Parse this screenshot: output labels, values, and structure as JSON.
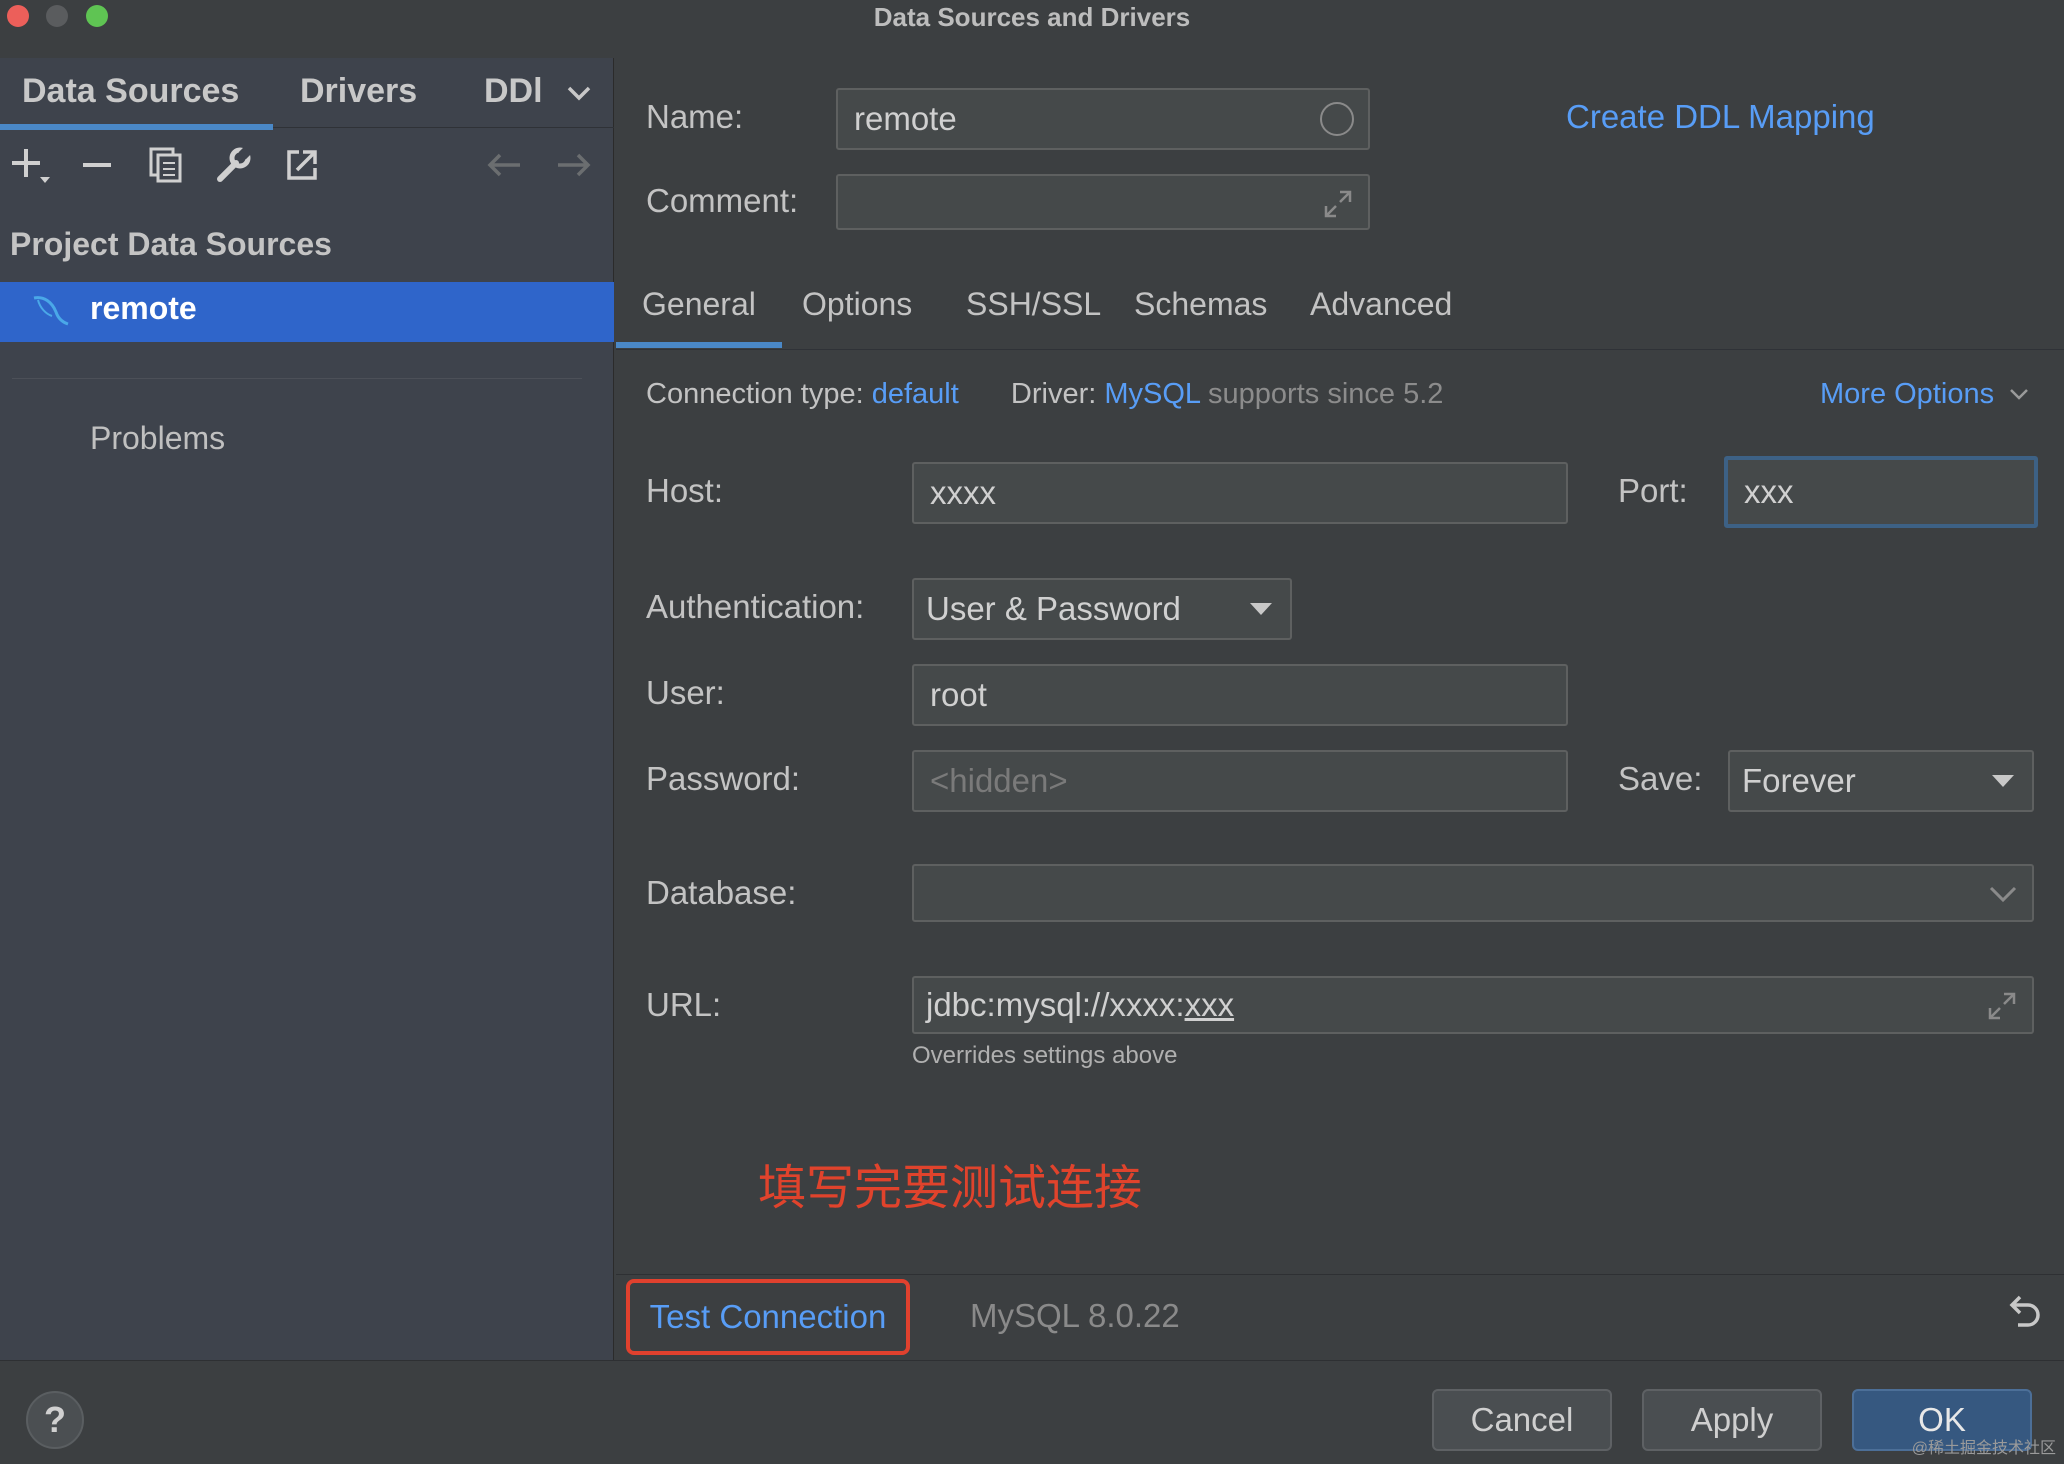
{
  "window": {
    "title": "Data Sources and Drivers"
  },
  "left": {
    "tabs": [
      "Data Sources",
      "Drivers",
      "DDl"
    ],
    "section_title": "Project Data Sources",
    "selected_source": "remote",
    "problems_label": "Problems"
  },
  "form": {
    "name_label": "Name:",
    "name_value": "remote",
    "create_ddl_link": "Create DDL Mapping",
    "comment_label": "Comment:",
    "comment_value": "",
    "tabs": [
      "General",
      "Options",
      "SSH/SSL",
      "Schemas",
      "Advanced"
    ],
    "connection_type_label": "Connection type:",
    "connection_type_value": "default",
    "driver_label": "Driver:",
    "driver_value": "MySQL",
    "driver_note": "supports since 5.2",
    "more_options": "More Options",
    "host_label": "Host:",
    "host_value": "xxxx",
    "port_label": "Port:",
    "port_value": "xxx",
    "auth_label": "Authentication:",
    "auth_value": "User & Password",
    "user_label": "User:",
    "user_value": "root",
    "password_label": "Password:",
    "password_placeholder": "<hidden>",
    "save_label": "Save:",
    "save_value": "Forever",
    "database_label": "Database:",
    "database_value": "",
    "url_label": "URL:",
    "url_prefix": "jdbc:mysql://xxxx:",
    "url_port": "xxx",
    "url_hint": "Overrides settings above"
  },
  "annotation": "填写完要测试连接",
  "bottom": {
    "test_connection": "Test Connection",
    "version": "MySQL 8.0.22"
  },
  "footer": {
    "help": "?",
    "cancel": "Cancel",
    "apply": "Apply",
    "ok": "OK",
    "watermark": "@稀土掘金技术社区"
  },
  "colors": {
    "accent": "#589df6",
    "selection": "#2f65ca",
    "annotation": "#e0432c",
    "highlight_border": "#e0412e"
  }
}
